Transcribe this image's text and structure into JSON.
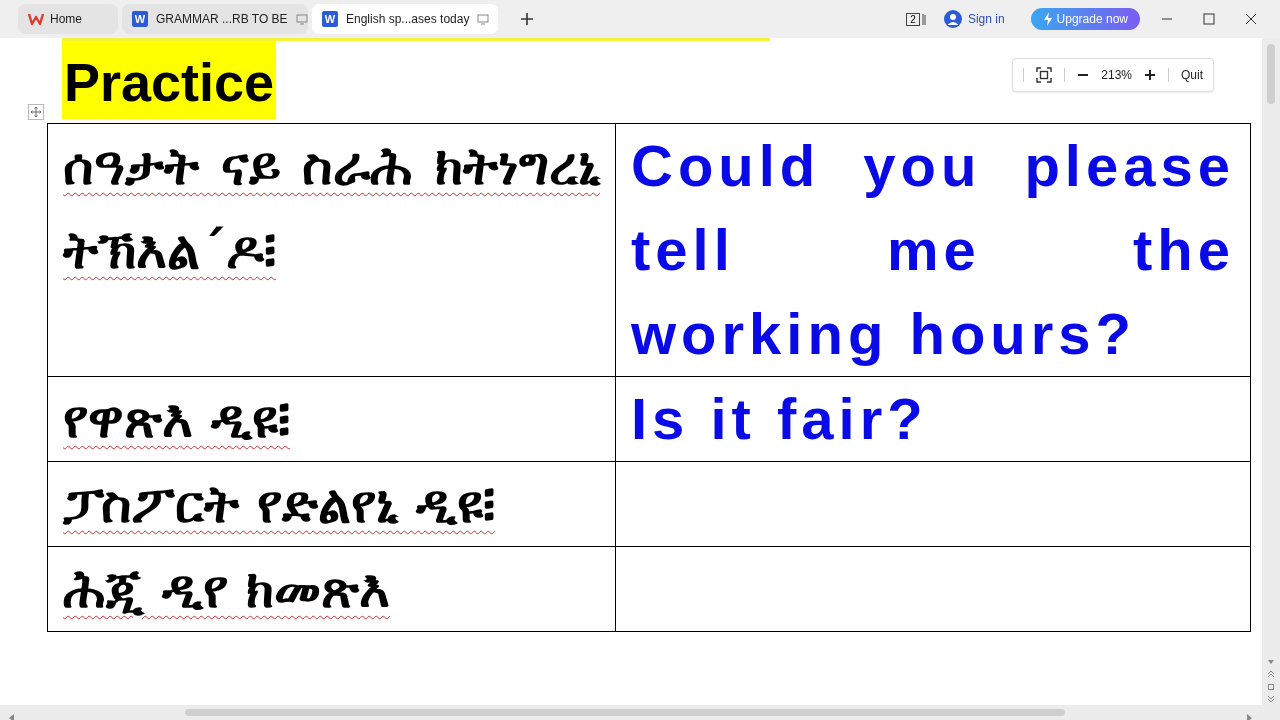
{
  "tabs": [
    {
      "label": "Home",
      "kind": "home",
      "selected": false
    },
    {
      "label": "GRAMMAR ...RB TO BE",
      "kind": "doc",
      "icon_letter": "W",
      "selected": false
    },
    {
      "label": "English sp...ases today",
      "kind": "doc",
      "icon_letter": "W",
      "selected": true
    }
  ],
  "titlebar": {
    "window_count": "2",
    "sign_in": "Sign in",
    "upgrade": "Upgrade now"
  },
  "zoom_bar": {
    "zoom": "213%",
    "quit": "Quit"
  },
  "document": {
    "heading": "Practice",
    "table": {
      "rows": [
        {
          "tigrinya": "ሰዓታት ናይ ስራሕ ክትነግረኒ ትኽእል´ዶ፧",
          "english": "Could you please tell me the working hours?"
        },
        {
          "tigrinya": "የዋጽእ ዲዩ፧",
          "english": "Is it fair?"
        },
        {
          "tigrinya": "ፓስፖርት የድልየኒ ዲዩ፧"
        },
        {
          "tigrinya": "ሕጂ ዲየ ክመጽእ"
        }
      ]
    }
  }
}
